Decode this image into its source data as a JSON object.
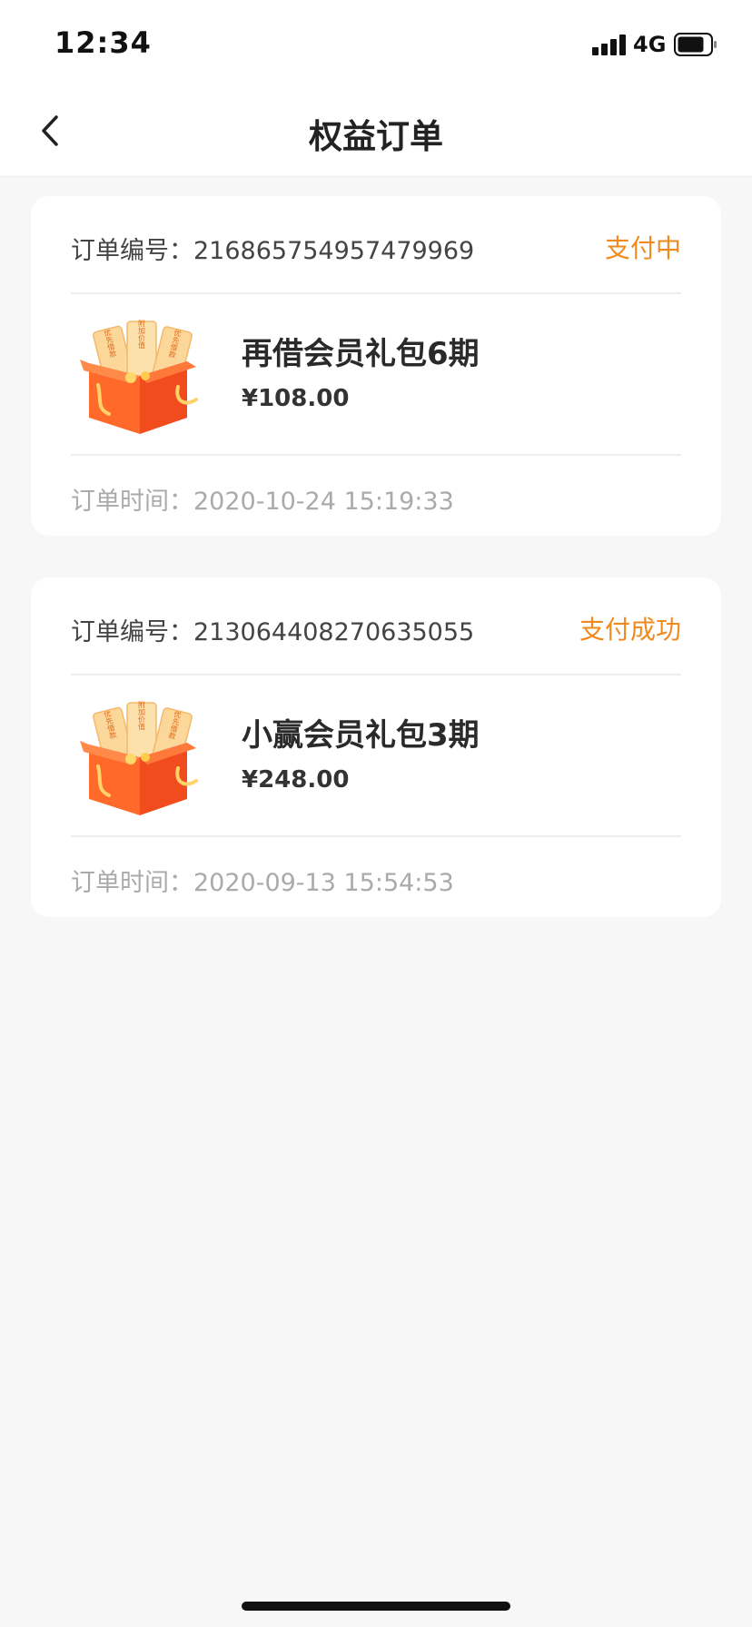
{
  "status_bar": {
    "time": "12:34",
    "network": "4G",
    "battery_level": 0.8
  },
  "nav": {
    "title": "权益订单",
    "back_icon": "chevron-left-icon"
  },
  "orders": [
    {
      "number_label": "订单编号：",
      "number": "216865754957479969",
      "status": "支付中",
      "product_icon": "gift-box-icon",
      "product_name": "再借会员礼包6期",
      "price": "¥108.00",
      "time_label": "订单时间：",
      "time": "2020-10-24 15:19:33"
    },
    {
      "number_label": "订单编号：",
      "number": "213064408270635055",
      "status": "支付成功",
      "product_icon": "gift-box-icon",
      "product_name": "小赢会员礼包3期",
      "price": "¥248.00",
      "time_label": "订单时间：",
      "time": "2020-09-13 15:54:53"
    }
  ],
  "gift_icon_text": [
    "优先借款",
    "附加价值",
    "优先借款"
  ],
  "colors": {
    "status_accent": "#f08a1e",
    "background": "#f7f7f7",
    "card": "#ffffff"
  }
}
